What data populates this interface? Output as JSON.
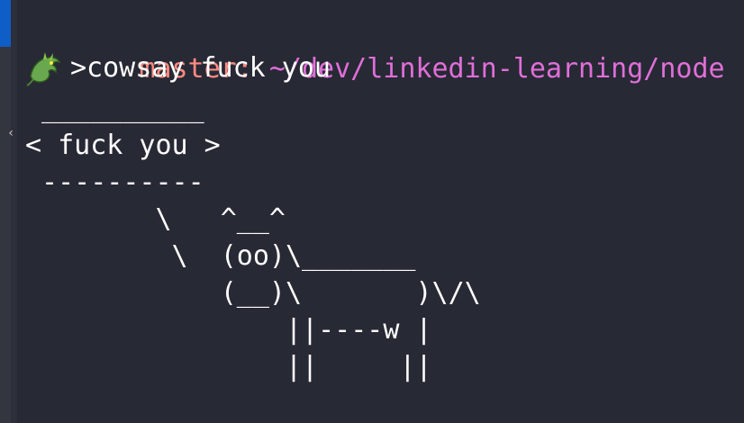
{
  "prompt": {
    "branch": "master:",
    "path": "~/dev/linkedin-learning/node"
  },
  "command": {
    "text": ">cowsay fuck you",
    "icon": "dragon-icon"
  },
  "output": {
    "lines": [
      " __________",
      "< fuck you >",
      " ----------",
      "        \\   ^__^",
      "         \\  (oo)\\_______",
      "            (__)\\       )\\/\\",
      "                ||----w |",
      "                ||     ||"
    ]
  },
  "colors": {
    "background": "#272935",
    "branch": "#ff8a80",
    "path": "#e06fd8",
    "text": "#ffffff"
  }
}
